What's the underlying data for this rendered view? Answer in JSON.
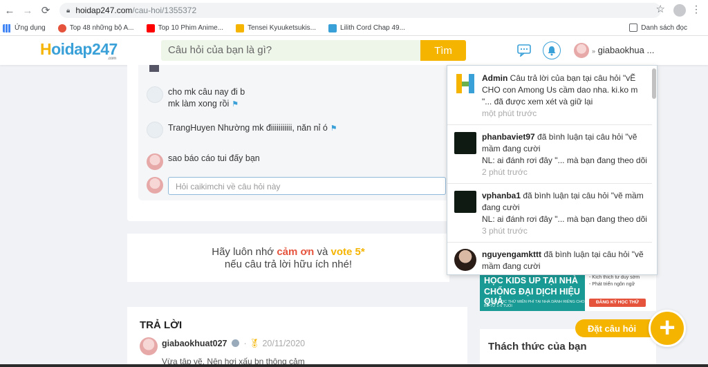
{
  "browser": {
    "url_host": "hoidap247.com",
    "url_path": "/cau-hoi/1355372",
    "bookmarks": [
      {
        "label": "Ứng dụng",
        "color": "#4285f4"
      },
      {
        "label": "Top 48 những bộ A...",
        "color": "#e5533c"
      },
      {
        "label": "Top 10 Phim Anime...",
        "color": "#ff0000"
      },
      {
        "label": "Tensei Kyuuketsukis...",
        "color": "#f5b400"
      },
      {
        "label": "Lilith Cord Chap 49...",
        "color": "#3aa0d8"
      }
    ],
    "reading_list": "Danh sách đọc"
  },
  "header": {
    "logo_h": "H",
    "logo_rest": "oidap247",
    "logo_com": ".com",
    "search_placeholder": "Câu hỏi của bạn là gì?",
    "search_button": "Tìm",
    "username": "giabaokhua ..."
  },
  "comments": [
    {
      "text_line1": "cho mk câu nay đi b",
      "text_line2": "mk làm xong rồi"
    },
    {
      "text_line1": "TrangHuyen Nhường mk điiiiiiiiiii, năn nỉ ó"
    },
    {
      "text_line1": "sao báo cáo tui đấy bạn"
    }
  ],
  "comment_input_placeholder": "Hỏi caikimchi về câu hỏi này",
  "thanks": {
    "pre": "Hãy luôn nhớ ",
    "thanks_word": "cảm ơn",
    "mid": " và ",
    "vote_word": "vote 5*",
    "line2": "nếu câu trả lời hữu ích nhé!"
  },
  "answer": {
    "title": "TRẢ LỜI",
    "user": "giabaokhuat027",
    "date": "20/11/2020",
    "body": "Vừa tập vẽ, Nên hơi xấu bn thông cảm"
  },
  "ad": {
    "line1": "HỌC KIDS UP TẠI NHÀ",
    "line2": "CHỐNG ĐẠI DỊCH HIỆU QUẢ",
    "line3": "ƯU ĐÃI HỌC THỬ MIỄN PHÍ TẠI NHÀ DÀNH RIÊNG CHO BÉ TỪ 1-6 TUỔI",
    "right1": "- Kích thích tư duy sớm",
    "right2": "- Phát triển ngôn ngữ",
    "cta": "ĐĂNG KÝ HỌC THỬ"
  },
  "challenge_title": "Thách thức của bạn",
  "ask_button": "Đặt câu hỏi",
  "notifications": [
    {
      "user": "Admin",
      "text": " Câu trả lời của bạn tại câu hỏi \"vẼ CHO con Among Us cầm dao nha. ki.ko m \"... đã được xem xét và giữ lại",
      "time": "một phút trước"
    },
    {
      "user": "phanbaviet97",
      "text": " đã bình luận tại câu hỏi \"vẽ mầm đang cười",
      "text2": "NL: ai đánh rơi đây \"... mà bạn đang theo dõi",
      "time": "2 phút trước"
    },
    {
      "user": "vphanba1",
      "text": " đã bình luận tại câu hỏi \"vẽ mầm đang cười",
      "text2": "NL: ai đánh rơi đây \"... mà bạn đang theo dõi",
      "time": "3 phút trước"
    },
    {
      "user": "nguyengamkttt",
      "text": " đã bình luận tại câu hỏi \"vẽ mầm đang cười"
    }
  ],
  "colors": {
    "brand_yellow": "#f5b400",
    "brand_blue": "#3aa0d8",
    "accent_red": "#e5533c"
  }
}
